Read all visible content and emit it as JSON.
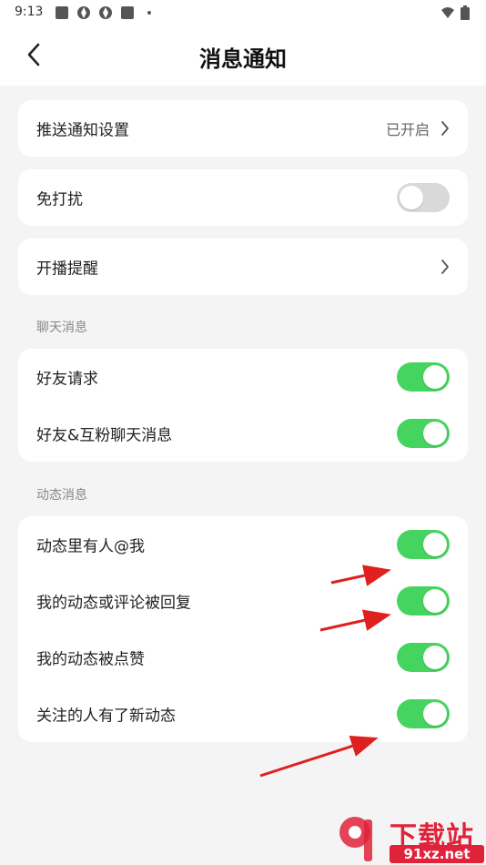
{
  "status_bar": {
    "time": "9:13",
    "left_icons": [
      "square-notification-icon",
      "aperture-icon",
      "aperture-icon",
      "square-notification-icon",
      "dot-icon"
    ],
    "right_icons": [
      "wifi-icon",
      "battery-icon"
    ]
  },
  "header": {
    "back_icon": "chevron-left-icon",
    "title": "消息通知"
  },
  "push_settings": {
    "label": "推送通知设置",
    "value": "已开启",
    "icon": "chevron-right-icon"
  },
  "do_not_disturb": {
    "label": "免打扰",
    "enabled": false
  },
  "live_reminder": {
    "label": "开播提醒",
    "icon": "chevron-right-icon"
  },
  "chat_section": {
    "title": "聊天消息",
    "items": [
      {
        "label": "好友请求",
        "enabled": true
      },
      {
        "label": "好友&互粉聊天消息",
        "enabled": true
      }
    ]
  },
  "activity_section": {
    "title": "动态消息",
    "items": [
      {
        "label": "动态里有人@我",
        "enabled": true
      },
      {
        "label": "我的动态或评论被回复",
        "enabled": true
      },
      {
        "label": "我的动态被点赞",
        "enabled": true
      },
      {
        "label": "关注的人有了新动态",
        "enabled": true
      }
    ]
  },
  "watermark": {
    "title": "下载站",
    "url": "91xz.net"
  },
  "colors": {
    "toggle_on": "#46d460",
    "toggle_off": "#d9d9d9",
    "arrow": "#e01f1f",
    "watermark": "#e0223a"
  }
}
